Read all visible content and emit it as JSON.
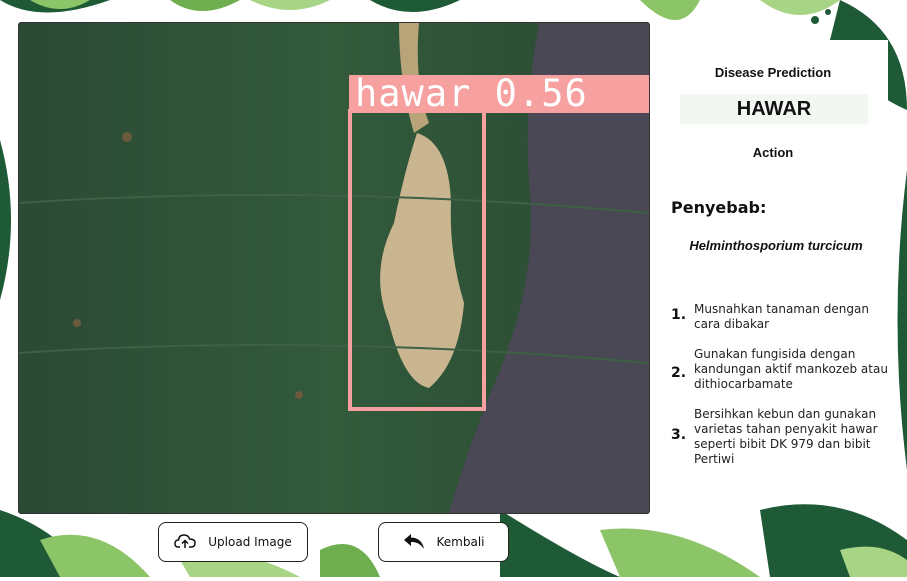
{
  "detection": {
    "label": "hawar 0.56",
    "box_color": "#f6a0a0"
  },
  "sidebar": {
    "prediction_heading": "Disease Prediction",
    "prediction_result": "HAWAR",
    "action_heading": "Action",
    "cause_heading": "Penyebab:",
    "cause_name": "Helminthosporium turcicum",
    "actions": [
      {
        "number": "1.",
        "text": "Musnahkan tanaman dengan cara dibakar"
      },
      {
        "number": "2.",
        "text": "Gunakan fungisida dengan kandungan aktif mankozeb atau dithiocarbamate"
      },
      {
        "number": "3.",
        "text": "Bersihkan kebun dan gunakan varietas tahan penyakit hawar seperti bibit DK 979 dan bibit Pertiwi"
      }
    ]
  },
  "buttons": {
    "upload_label": "Upload Image",
    "back_label": "Kembali"
  },
  "icons": {
    "upload": "cloud-upload-icon",
    "back": "back-arrow-icon"
  },
  "colors": {
    "leaf_dark": "#1f5a36",
    "leaf_light": "#8cc468"
  }
}
